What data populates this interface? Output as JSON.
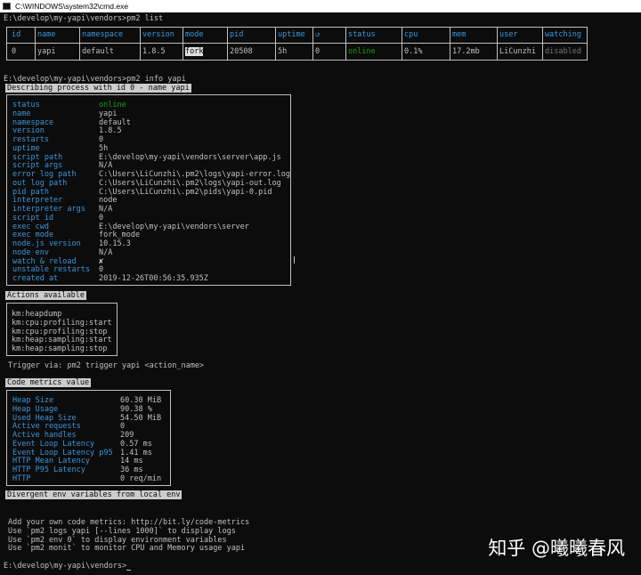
{
  "window": {
    "title": "C:\\WINDOWS\\system32\\cmd.exe"
  },
  "prompt1": "E:\\develop\\my-yapi\\vendors>pm2 list",
  "list_table": {
    "headers": [
      "id",
      "name",
      "namespace",
      "version",
      "mode",
      "pid",
      "uptime",
      "↺",
      "status",
      "cpu",
      "mem",
      "user",
      "watching"
    ],
    "row": [
      "0",
      "yapi",
      "default",
      "1.8.5",
      "fork",
      "20508",
      "5h",
      "0",
      "online",
      "0.1%",
      "17.2mb",
      "LiCunzhi",
      "disabled"
    ]
  },
  "prompt2": "E:\\develop\\my-yapi\\vendors>pm2 info yapi",
  "describe_header": "Describing process with id 0 - name yapi",
  "info": [
    {
      "k": "status",
      "v": "online"
    },
    {
      "k": "name",
      "v": "yapi"
    },
    {
      "k": "namespace",
      "v": "default"
    },
    {
      "k": "version",
      "v": "1.8.5"
    },
    {
      "k": "restarts",
      "v": "0"
    },
    {
      "k": "uptime",
      "v": "5h"
    },
    {
      "k": "script path",
      "v": "E:\\develop\\my-yapi\\vendors\\server\\app.js"
    },
    {
      "k": "script args",
      "v": "N/A"
    },
    {
      "k": "error log path",
      "v": "C:\\Users\\LiCunzhi\\.pm2\\logs\\yapi-error.log"
    },
    {
      "k": "out log path",
      "v": "C:\\Users\\LiCunzhi\\.pm2\\logs\\yapi-out.log"
    },
    {
      "k": "pid path",
      "v": "C:\\Users\\LiCunzhi\\.pm2\\pids\\yapi-0.pid"
    },
    {
      "k": "interpreter",
      "v": "node"
    },
    {
      "k": "interpreter args",
      "v": "N/A"
    },
    {
      "k": "script id",
      "v": "0"
    },
    {
      "k": "exec cwd",
      "v": "E:\\develop\\my-yapi\\vendors\\server"
    },
    {
      "k": "exec mode",
      "v": "fork_mode"
    },
    {
      "k": "node.js version",
      "v": "10.15.3"
    },
    {
      "k": "node env",
      "v": "N/A"
    },
    {
      "k": "watch & reload",
      "v": "✘"
    },
    {
      "k": "unstable restarts",
      "v": "0"
    },
    {
      "k": "created at",
      "v": "2019-12-26T00:56:35.935Z"
    }
  ],
  "actions_header": "Actions available",
  "actions": [
    "km:heapdump",
    "km:cpu:profiling:start",
    "km:cpu:profiling:stop",
    "km:heap:sampling:start",
    "km:heap:sampling:stop"
  ],
  "trigger_line": "Trigger via: pm2 trigger yapi <action_name>",
  "metrics_header": "Code metrics value",
  "metrics": [
    {
      "k": "Heap Size",
      "v": "60.30 MiB"
    },
    {
      "k": "Heap Usage",
      "v": "90.38 %"
    },
    {
      "k": "Used Heap Size",
      "v": "54.50 MiB"
    },
    {
      "k": "Active requests",
      "v": "0"
    },
    {
      "k": "Active handles",
      "v": "209"
    },
    {
      "k": "Event Loop Latency",
      "v": "0.57 ms"
    },
    {
      "k": "Event Loop Latency p95",
      "v": "1.41 ms"
    },
    {
      "k": "HTTP Mean Latency",
      "v": "14 ms"
    },
    {
      "k": "HTTP P95 Latency",
      "v": "36 ms"
    },
    {
      "k": "HTTP",
      "v": "0 req/min"
    }
  ],
  "divergent_header": "Divergent env variables from local env",
  "footer_lines": [
    "Add your own code metrics: http://bit.ly/code-metrics",
    "Use `pm2 logs yapi [--lines 1000]` to display logs",
    "Use `pm2 env 0` to display environment variables",
    "Use `pm2 monit` to monitor CPU and Memory usage yapi"
  ],
  "prompt3": "E:\\develop\\my-yapi\\vendors>",
  "watermark": "知乎 @曦曦春风",
  "colors": {
    "background": "#0c0c0c",
    "text": "#c0c0c0",
    "key": "#3a96dd",
    "online": "#13a10e"
  }
}
